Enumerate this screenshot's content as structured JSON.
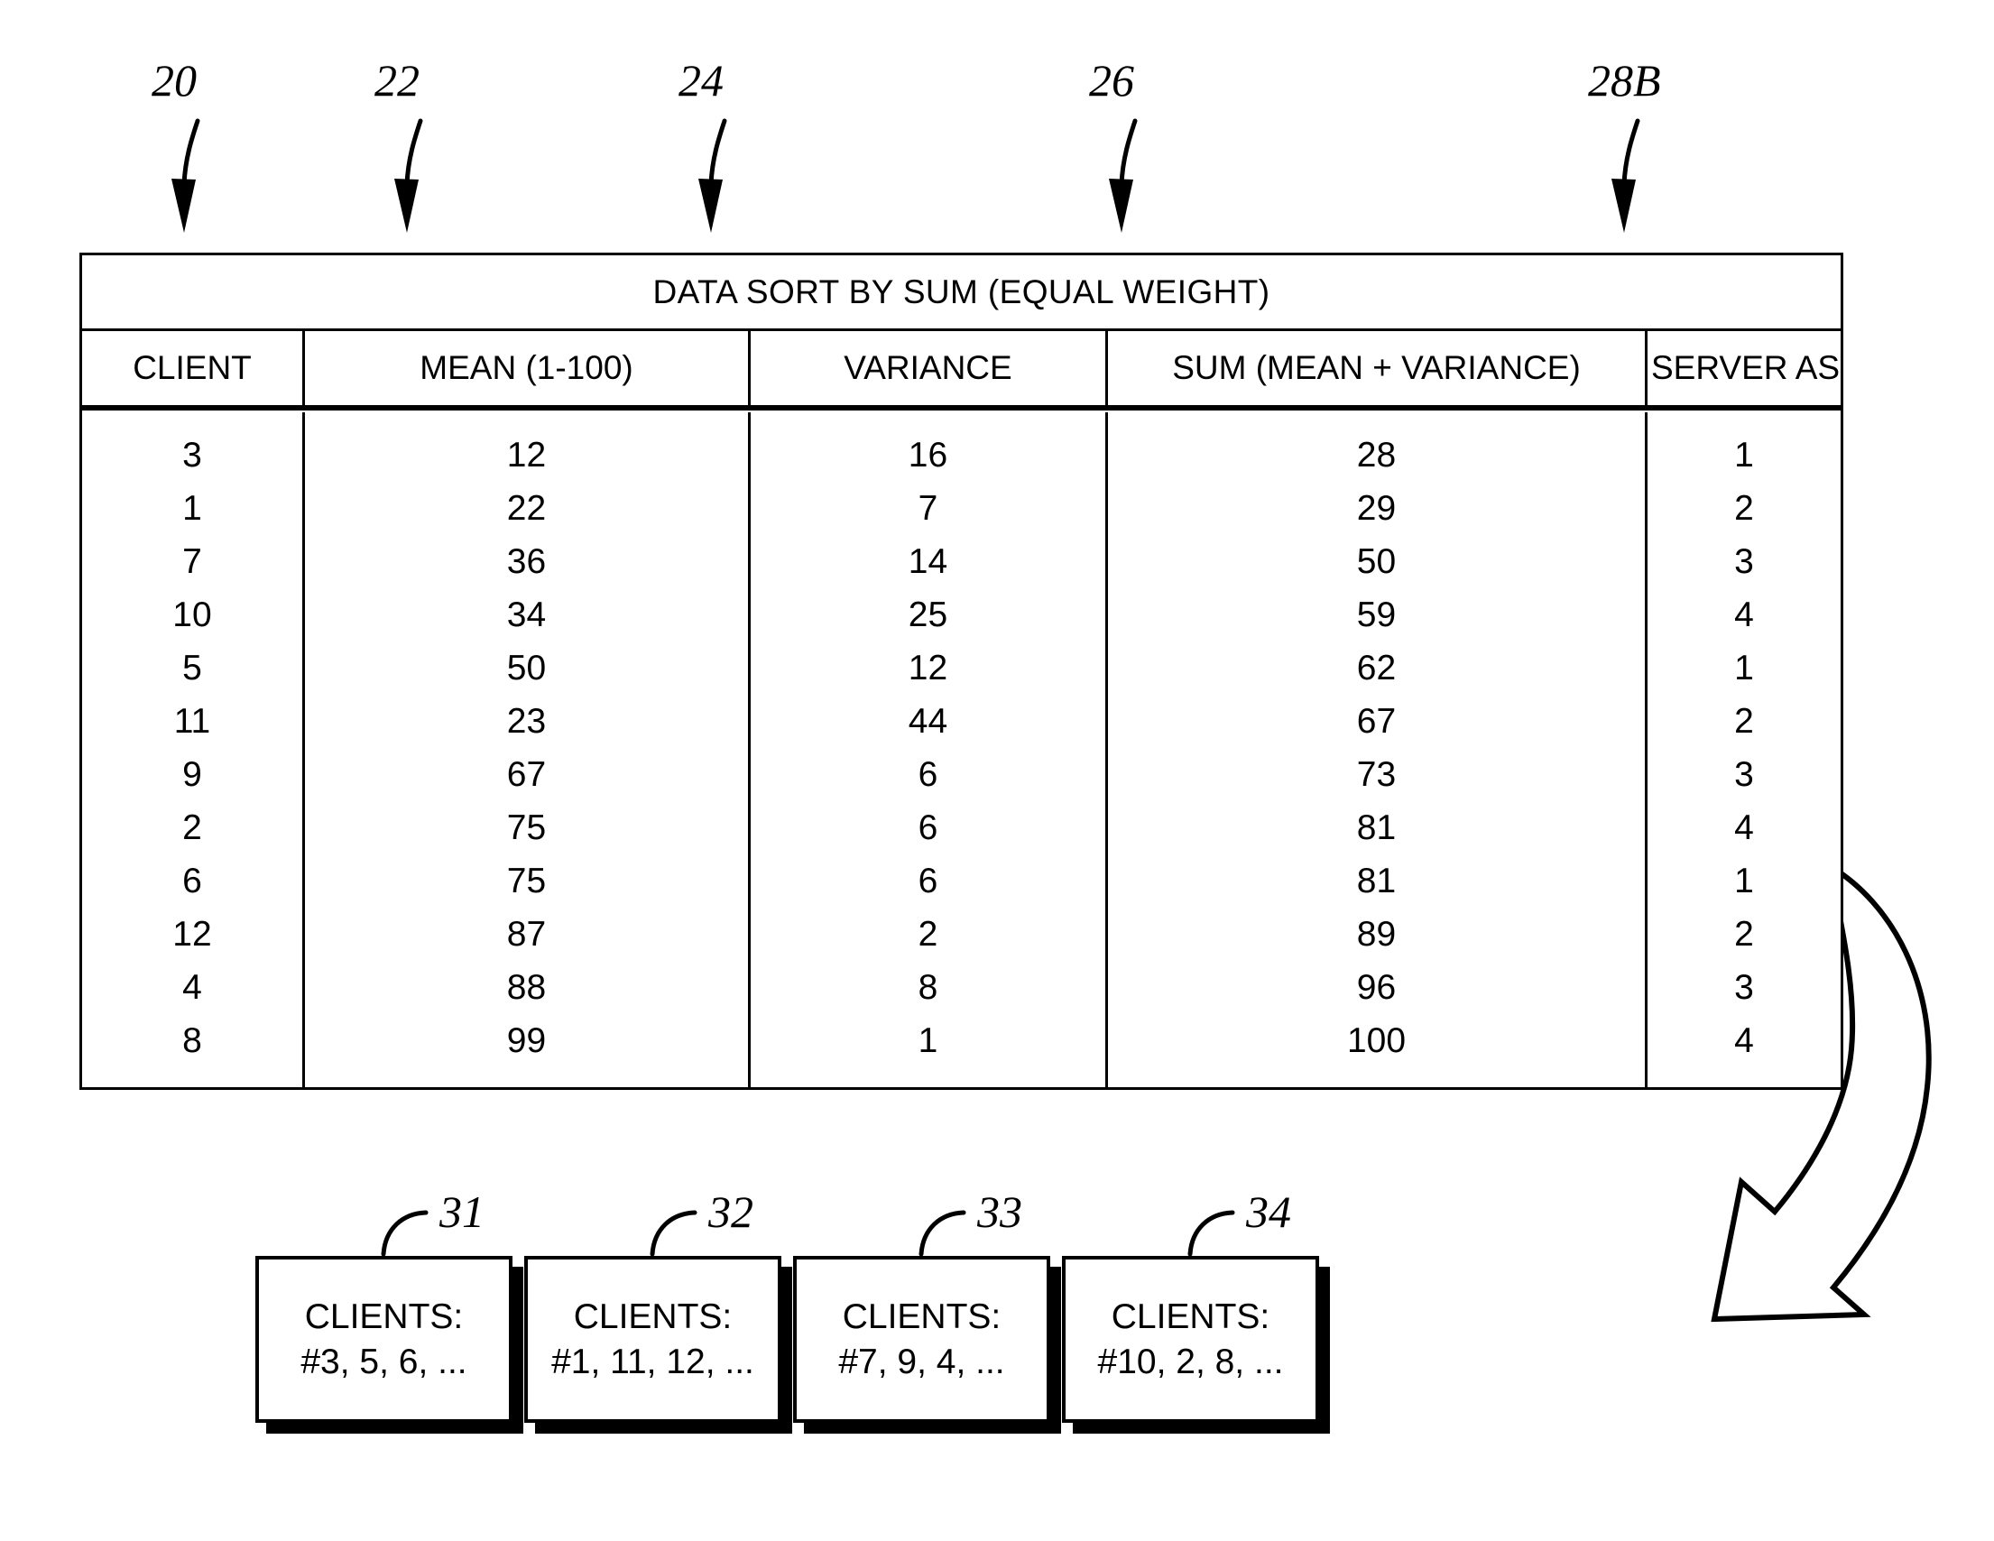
{
  "figure": {
    "title": "DATA SORT BY SUM (EQUAL WEIGHT)",
    "table_ref": "20",
    "callouts": [
      {
        "id": "20",
        "label": "20",
        "target": "client-column"
      },
      {
        "id": "22",
        "label": "22",
        "target": "mean-column"
      },
      {
        "id": "24",
        "label": "24",
        "target": "variance-column"
      },
      {
        "id": "26",
        "label": "26",
        "target": "sum-column"
      },
      {
        "id": "28B",
        "label": "28B",
        "target": "server-assignment-column"
      }
    ]
  },
  "table": {
    "title": "DATA SORT BY SUM (EQUAL WEIGHT)",
    "columns": [
      "CLIENT",
      "MEAN (1-100)",
      "VARIANCE",
      "SUM (MEAN + VARIANCE)",
      "SERVER ASSIGNMENT"
    ],
    "rows": [
      {
        "client": "3",
        "mean": "12",
        "variance": "16",
        "sum": "28",
        "server": "1"
      },
      {
        "client": "1",
        "mean": "22",
        "variance": "7",
        "sum": "29",
        "server": "2"
      },
      {
        "client": "7",
        "mean": "36",
        "variance": "14",
        "sum": "50",
        "server": "3"
      },
      {
        "client": "10",
        "mean": "34",
        "variance": "25",
        "sum": "59",
        "server": "4"
      },
      {
        "client": "5",
        "mean": "50",
        "variance": "12",
        "sum": "62",
        "server": "1"
      },
      {
        "client": "11",
        "mean": "23",
        "variance": "44",
        "sum": "67",
        "server": "2"
      },
      {
        "client": "9",
        "mean": "67",
        "variance": "6",
        "sum": "73",
        "server": "3"
      },
      {
        "client": "2",
        "mean": "75",
        "variance": "6",
        "sum": "81",
        "server": "4"
      },
      {
        "client": "6",
        "mean": "75",
        "variance": "6",
        "sum": "81",
        "server": "1"
      },
      {
        "client": "12",
        "mean": "87",
        "variance": "2",
        "sum": "89",
        "server": "2"
      },
      {
        "client": "4",
        "mean": "88",
        "variance": "8",
        "sum": "96",
        "server": "3"
      },
      {
        "client": "8",
        "mean": "99",
        "variance": "1",
        "sum": "100",
        "server": "4"
      }
    ]
  },
  "server_boxes": [
    {
      "ref": "31",
      "label": "CLIENTS:",
      "clients": "#3, 5, 6, ..."
    },
    {
      "ref": "32",
      "label": "CLIENTS:",
      "clients": "#1, 11, 12, ..."
    },
    {
      "ref": "33",
      "label": "CLIENTS:",
      "clients": "#7, 9, 4, ..."
    },
    {
      "ref": "34",
      "label": "CLIENTS:",
      "clients": "#10, 2, 8, ..."
    }
  ],
  "flow_arrow": {
    "name": "assignment-flow-arrow",
    "description": "curved block arrow from table to server boxes"
  },
  "colors": {
    "ink": "#000000",
    "paper": "#ffffff"
  }
}
